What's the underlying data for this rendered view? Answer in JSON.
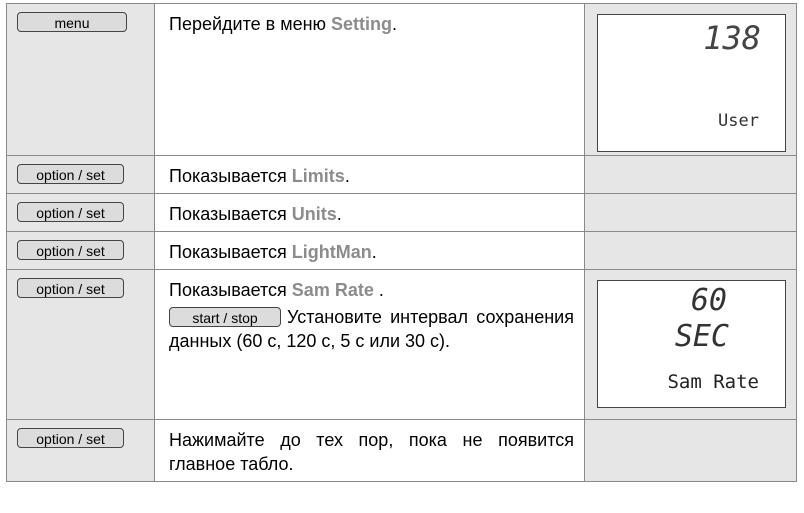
{
  "rows": [
    {
      "key": "menu",
      "pre": "Перейдите в меню ",
      "hl": "Setting",
      "post": ".",
      "display": {
        "value": "138",
        "label": "User"
      }
    },
    {
      "key": "option / set",
      "pre": "Показывается ",
      "hl": "Limits",
      "post": "."
    },
    {
      "key": "option / set",
      "pre": "Показывается ",
      "hl": "Units",
      "post": "."
    },
    {
      "key": "option / set",
      "pre": "Показывается ",
      "hl": "LightMan",
      "post": "."
    },
    {
      "key": "option / set",
      "pre": "Показывается ",
      "hl": "Sam Rate",
      "post": " .",
      "sub_key": "start / stop",
      "sub_text": "Установите интервал сохранения данных (60 с, 120 с, 5 с или 30 с).",
      "display": {
        "value": "60",
        "unit": "SEC",
        "label": "Sam Rate"
      }
    },
    {
      "key": "option / set",
      "text": "Нажимайте до тех пор, пока не появится главное табло."
    }
  ]
}
